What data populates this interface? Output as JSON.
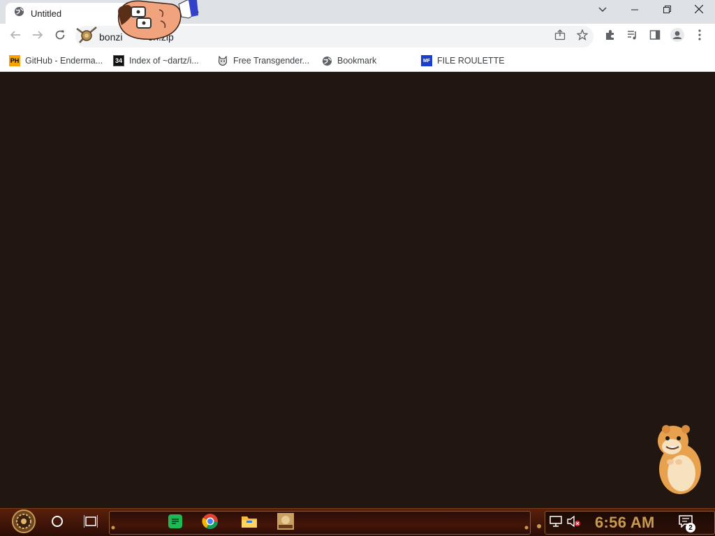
{
  "window": {
    "tab_title": "Untitled",
    "controls": [
      "minimize",
      "restore",
      "close"
    ]
  },
  "toolbar": {
    "address_prefix": "bonzi",
    "address_suffix": "on.zip"
  },
  "bookmarks": [
    {
      "label": "GitHub - Enderma...",
      "icon": "PH"
    },
    {
      "label": "Index of ~dartz/i...",
      "icon": "34"
    },
    {
      "label": "Free Transgender...",
      "icon": "cat-icon"
    },
    {
      "label": "Bookmark",
      "icon": "globe-icon"
    },
    {
      "label": "FILE ROULETTE",
      "icon": "MF"
    }
  ],
  "taskbar": {
    "clock": "6:56 AM",
    "notification_count": "2",
    "apps": [
      "spotify",
      "chrome",
      "file-explorer",
      "game"
    ]
  },
  "colors": {
    "page_background": "#221610",
    "chrome_frame": "#dee1e6",
    "taskbar": "#3d1408",
    "clock": "#c99a4e"
  }
}
